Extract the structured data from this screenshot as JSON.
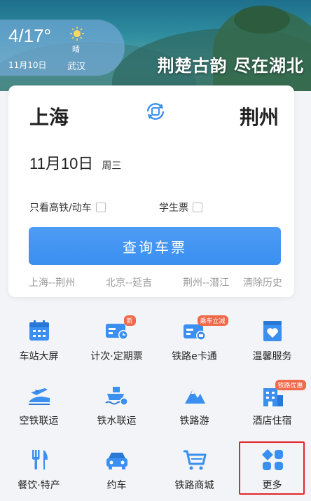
{
  "banner": {
    "slogan": "荆楚古韵 尽在湖北",
    "weather": {
      "temp": "4/17°",
      "condition": "晴",
      "date": "11月10日",
      "city": "武汉"
    }
  },
  "search": {
    "from": "上海",
    "to": "荆州",
    "date": "11月10日",
    "weekday": "周三",
    "option_high_speed": "只看高铁/动车",
    "option_student": "学生票",
    "query_button": "查询车票",
    "history": [
      "上海--荆州",
      "北京--延吉",
      "荆州--潜江"
    ],
    "clear_history": "清除历史"
  },
  "grid": [
    {
      "label": "车站大屏",
      "icon": "station-screen-icon"
    },
    {
      "label": "计次·定期票",
      "icon": "ticket-card-icon",
      "badge": "新"
    },
    {
      "label": "铁路e卡通",
      "icon": "e-card-icon",
      "badge": "乘车立减"
    },
    {
      "label": "温馨服务",
      "icon": "heart-service-icon"
    },
    {
      "label": "空铁联运",
      "icon": "plane-rail-icon"
    },
    {
      "label": "铁水联运",
      "icon": "ship-rail-icon"
    },
    {
      "label": "铁路游",
      "icon": "mountain-tour-icon"
    },
    {
      "label": "酒店住宿",
      "icon": "hotel-icon",
      "badge": "铁路优惠"
    },
    {
      "label": "餐饮·特产",
      "icon": "dining-icon"
    },
    {
      "label": "约车",
      "icon": "car-icon"
    },
    {
      "label": "铁路商城",
      "icon": "shopping-cart-icon"
    },
    {
      "label": "更多",
      "icon": "more-grid-icon"
    }
  ],
  "colors": {
    "accent": "#3a8ff0",
    "badge": "#f06a4a",
    "highlight": "#e0262a"
  }
}
